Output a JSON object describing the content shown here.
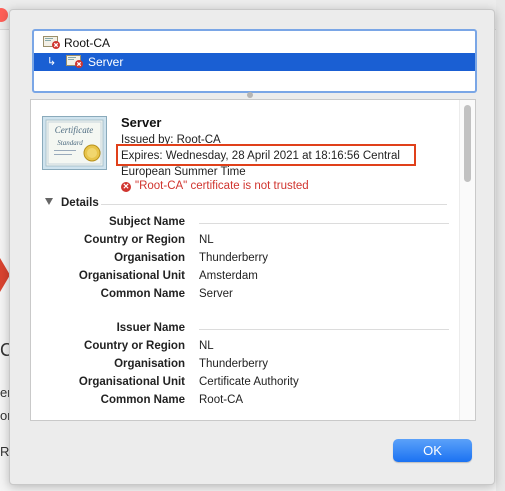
{
  "chain": {
    "items": [
      {
        "label": "Root-CA",
        "icon": "certificate-error-icon"
      },
      {
        "label": "Server",
        "icon": "certificate-error-icon",
        "arrow": "↳",
        "selected": true
      }
    ]
  },
  "certificate": {
    "name": "Server",
    "issued_by": "Issued by: Root-CA",
    "expires_line1": "Expires: Wednesday, 28 April 2021 at 18:16:56 Central",
    "expires_line2": "European Summer Time",
    "trust_status": "\"Root-CA\" certificate is not trusted",
    "image_text1": "Certificate",
    "image_text2": "Standard"
  },
  "details": {
    "toggle_label": "Details",
    "subject": {
      "heading": "Subject Name",
      "fields": [
        {
          "key": "Country or Region",
          "value": "NL"
        },
        {
          "key": "Organisation",
          "value": "Thunderberry"
        },
        {
          "key": "Organisational Unit",
          "value": "Amsterdam"
        },
        {
          "key": "Common Name",
          "value": "Server"
        }
      ]
    },
    "issuer": {
      "heading": "Issuer Name",
      "fields": [
        {
          "key": "Country or Region",
          "value": "NL"
        },
        {
          "key": "Organisation",
          "value": "Thunderberry"
        },
        {
          "key": "Organisational Unit",
          "value": "Certificate Authority"
        },
        {
          "key": "Common Name",
          "value": "Root-CA"
        }
      ]
    }
  },
  "buttons": {
    "ok": "OK"
  },
  "background": {
    "letters": [
      "C",
      "er",
      "or",
      "R"
    ]
  },
  "colors": {
    "selection": "#1a5fd3",
    "error": "#d0352f",
    "highlight": "#e0401a",
    "ok_button": "#1b72f2"
  }
}
